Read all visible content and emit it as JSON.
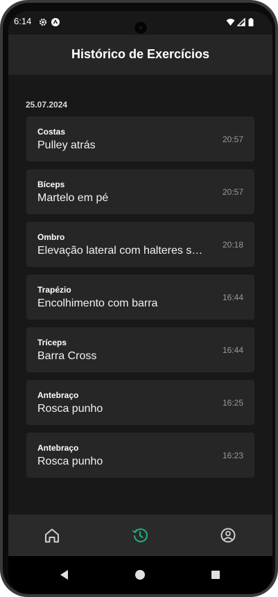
{
  "status_bar": {
    "time": "6:14",
    "icons": [
      "gear-icon",
      "app-a-icon",
      "wifi-icon",
      "signal-icon",
      "battery-icon"
    ]
  },
  "header": {
    "title": "Histórico de Exercícios"
  },
  "history": {
    "date": "25.07.2024",
    "entries": [
      {
        "category": "Costas",
        "exercise": "Pulley atrás",
        "time": "20:57"
      },
      {
        "category": "Bíceps",
        "exercise": "Martelo em pé",
        "time": "20:57"
      },
      {
        "category": "Ombro",
        "exercise": "Elevação lateral com halteres s…",
        "time": "20:18"
      },
      {
        "category": "Trapézio",
        "exercise": "Encolhimento com barra",
        "time": "16:44"
      },
      {
        "category": "Tríceps",
        "exercise": "Barra Cross",
        "time": "16:44"
      },
      {
        "category": "Antebraço",
        "exercise": "Rosca punho",
        "time": "16:25"
      },
      {
        "category": "Antebraço",
        "exercise": "Rosca punho",
        "time": "16:23"
      }
    ]
  },
  "bottom_nav": {
    "items": [
      {
        "icon": "home-icon",
        "active": false
      },
      {
        "icon": "history-icon",
        "active": true
      },
      {
        "icon": "profile-icon",
        "active": false
      }
    ],
    "active_color": "#1db47a",
    "inactive_color": "#d0d0d0"
  },
  "system_nav": [
    "back-icon",
    "home-circle-icon",
    "recents-icon"
  ]
}
